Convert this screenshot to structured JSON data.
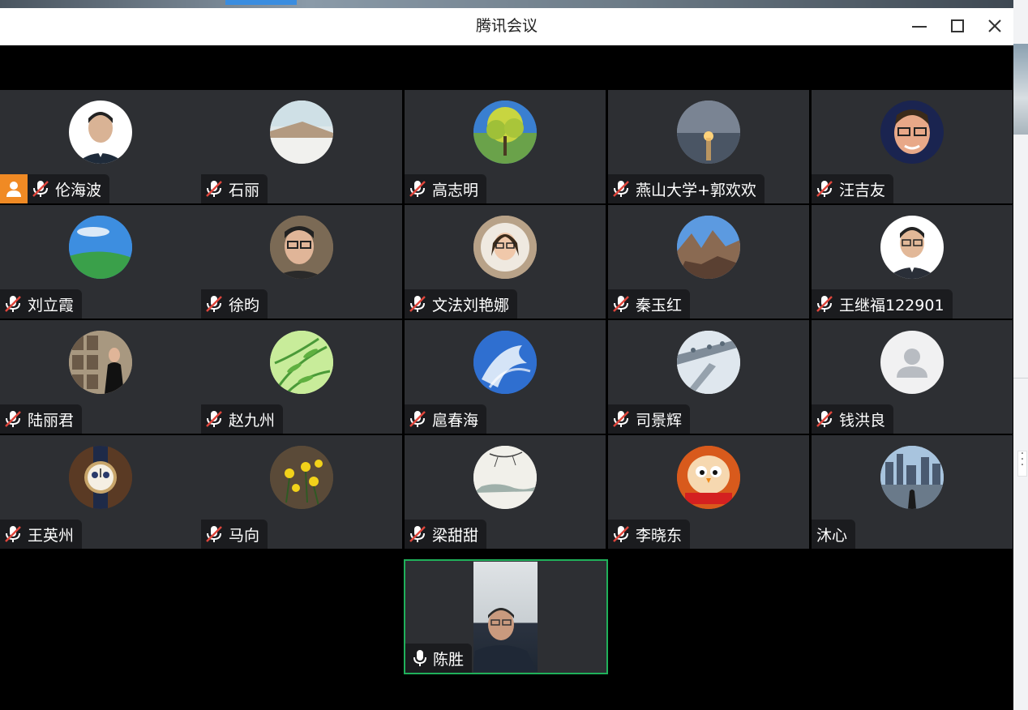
{
  "window": {
    "title": "腾讯会议"
  },
  "colors": {
    "tile_bg": "#2d2f33",
    "nameplate_bg": "#1b1c1f",
    "host_badge": "#f08a24",
    "speaker_border": "#1fb05a",
    "muted_slash": "#e0463c"
  },
  "participants": [
    {
      "name": "伦海波",
      "muted": true,
      "host": true,
      "avatar": "man-portrait"
    },
    {
      "name": "石丽",
      "muted": true,
      "avatar": "beach-scene"
    },
    {
      "name": "高志明",
      "muted": true,
      "avatar": "tree"
    },
    {
      "name": "燕山大学+郭欢欢",
      "muted": true,
      "avatar": "sunset-sea"
    },
    {
      "name": "汪吉友",
      "muted": true,
      "avatar": "man-glasses"
    },
    {
      "name": "刘立霞",
      "muted": true,
      "avatar": "blue-sky-field"
    },
    {
      "name": "徐昀",
      "muted": true,
      "avatar": "man-selfie"
    },
    {
      "name": "文法刘艳娜",
      "muted": true,
      "avatar": "woman-glasses"
    },
    {
      "name": "秦玉红",
      "muted": true,
      "avatar": "mountains"
    },
    {
      "name": "王继福122901",
      "muted": true,
      "avatar": "man-suit"
    },
    {
      "name": "陆丽君",
      "muted": true,
      "avatar": "woman-gallery"
    },
    {
      "name": "赵九州",
      "muted": true,
      "avatar": "bamboo"
    },
    {
      "name": "扈春海",
      "muted": true,
      "avatar": "blue-wave"
    },
    {
      "name": "司景辉",
      "muted": true,
      "avatar": "winter-aerial"
    },
    {
      "name": "钱洪良",
      "muted": true,
      "avatar": "default-user"
    },
    {
      "name": "王英州",
      "muted": true,
      "avatar": "watch"
    },
    {
      "name": "马向",
      "muted": true,
      "avatar": "yellow-flowers"
    },
    {
      "name": "梁甜甜",
      "muted": true,
      "avatar": "ink-painting"
    },
    {
      "name": "李晓东",
      "muted": true,
      "avatar": "cartoon-bird"
    },
    {
      "name": "沐心",
      "muted": false,
      "nomic": true,
      "avatar": "city-skyline"
    }
  ],
  "speaker": {
    "name": "陈胜",
    "muted": false
  },
  "icons": {
    "minimize": "minimize-icon",
    "maximize": "maximize-icon",
    "close": "close-icon",
    "mic_muted": "mic-muted-icon",
    "mic_on": "mic-icon",
    "host": "host-icon"
  }
}
